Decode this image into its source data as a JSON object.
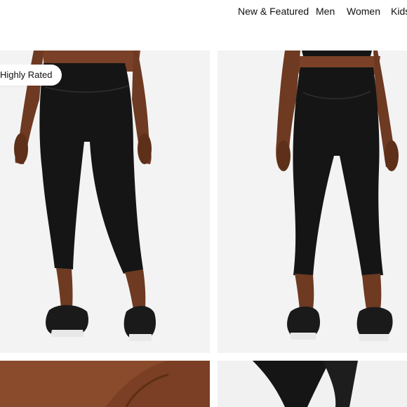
{
  "nav": {
    "items": [
      {
        "label": "New & Featured"
      },
      {
        "label": "Men"
      },
      {
        "label": "Women"
      },
      {
        "label": "Kids"
      }
    ]
  },
  "gallery": {
    "badge": "Highly Rated",
    "images": [
      {
        "name": "leggings-front-view"
      },
      {
        "name": "leggings-back-view"
      },
      {
        "name": "skin-closeup"
      },
      {
        "name": "waistband-detail"
      }
    ]
  },
  "colors": {
    "tile_bg": "#f3f3f3",
    "garment": "#151515",
    "skin": "#8a4a2c"
  }
}
